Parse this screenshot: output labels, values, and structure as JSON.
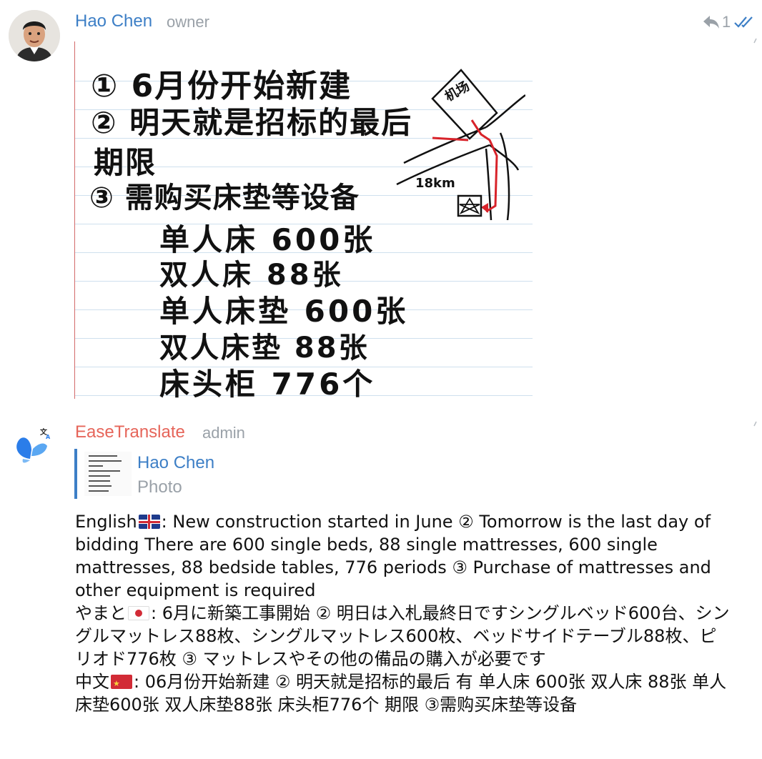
{
  "message1": {
    "sender": "Hao Chen",
    "role": "owner",
    "reply_count": "1",
    "note_lines": [
      "① 6月份开始新建",
      "② 明天就是招标的最后",
      "期限",
      "③ 需购买床垫等设备"
    ],
    "note_items": [
      "单人床  600张",
      "双人床  88张",
      "单人床垫 600张",
      "双人床垫 88张",
      "床头柜  776个"
    ],
    "map_labels": {
      "airport": "机场",
      "distance": "18km"
    }
  },
  "message2": {
    "sender": "EaseTranslate",
    "role": "admin",
    "quote": {
      "author": "Hao Chen",
      "type": "Photo"
    },
    "translations": {
      "en_label": "English",
      "en_text": ": New construction started in June ② Tomorrow is the last day of bidding There are 600 single beds, 88 single mattresses, 600 single mattresses, 88 bedside tables, 776 periods ③ Purchase of mattresses and other equipment is required",
      "ja_label": "やまと",
      "ja_text": ": 6月に新築工事開始 ② 明日は入札最終日ですシングルベッド600台、シングルマットレス88枚、シングルマットレス600枚、ベッドサイドテーブル88枚、ピリオド776枚 ③ マットレスやその他の備品の購入が必要です",
      "zh_label": "中文",
      "zh_text": ": 06月份开始新建 ② 明天就是招标的最后 有 单人床 600张 双人床 88张 单人床垫600张 双人床垫88张 床头柜776个 期限 ③需购买床垫等设备"
    }
  },
  "icons": {
    "reply": "reply-icon",
    "read": "double-check-icon",
    "bot_avatar": "butterfly-translate-icon"
  },
  "colors": {
    "name_blue": "#3d7fc6",
    "name_red": "#e6655a",
    "muted": "#9aa1a8"
  }
}
